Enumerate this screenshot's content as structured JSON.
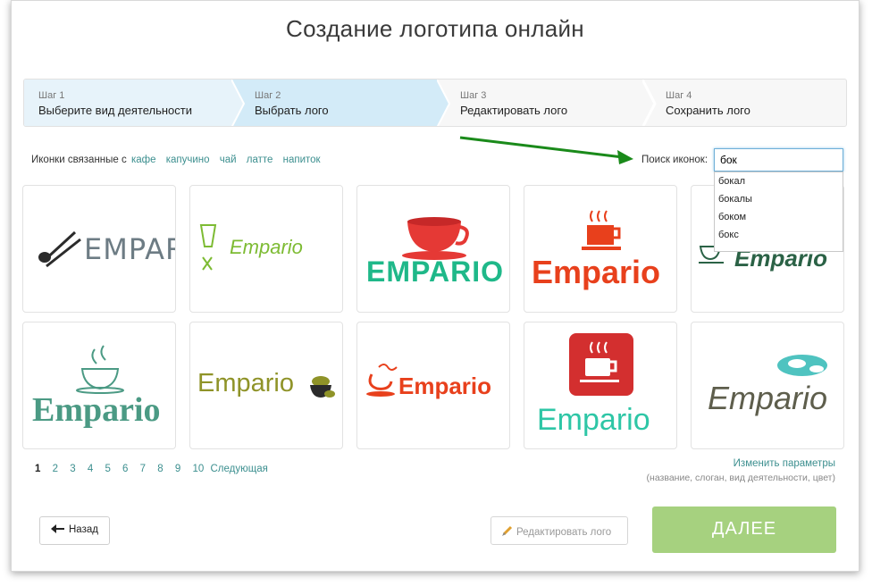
{
  "page": {
    "title": "Создание логотипа онлайн"
  },
  "steps": [
    {
      "num": "Шаг 1",
      "label": "Выберите вид деятельности"
    },
    {
      "num": "Шаг 2",
      "label": "Выбрать лого"
    },
    {
      "num": "Шаг 3",
      "label": "Редактировать лого"
    },
    {
      "num": "Шаг 4",
      "label": "Сохранить лого"
    }
  ],
  "related": {
    "prefix": "Иконки связанные с",
    "tags": [
      "кафе",
      "капучино",
      "чай",
      "латте",
      "напиток"
    ]
  },
  "search": {
    "label": "Поиск иконок:",
    "value": "бок",
    "suggestions": [
      "бокал",
      "бокалы",
      "боком",
      "бокс"
    ]
  },
  "logos": [
    {
      "text": "EMPARIO",
      "color": "#6d7c84",
      "icon": "chopsticks-sushi-icon"
    },
    {
      "text": "Empario",
      "color": "#7dbb33",
      "icon": "drink-utensils-icon"
    },
    {
      "text": "EMPARIO",
      "color": "#1fb889",
      "icon": "red-cup-icon"
    },
    {
      "text": "Empario",
      "color": "#e8401c",
      "icon": "steaming-cup-icon"
    },
    {
      "text": "Empario",
      "color": "#2b6246",
      "icon": "cup-outline-icon"
    },
    {
      "text": "Empario",
      "color": "#4b9a84",
      "icon": "coffee-cup-outline-icon"
    },
    {
      "text": "Empario",
      "color": "#8f9328",
      "icon": "coffee-beans-cup-icon"
    },
    {
      "text": "Empario",
      "color": "#e8401c",
      "icon": "swirl-cup-icon"
    },
    {
      "text": "Empario",
      "color": "#2ec6a6",
      "icon": "cup-badge-icon"
    },
    {
      "text": "Empario",
      "color": "#5e5e4c",
      "icon": "sushi-roll-icon"
    }
  ],
  "pagination": {
    "pages": [
      "1",
      "2",
      "3",
      "4",
      "5",
      "6",
      "7",
      "8",
      "9",
      "10"
    ],
    "next": "Следующая",
    "current": "1"
  },
  "change": {
    "link": "Изменить параметры",
    "hint": "(название, слоган, вид деятельности, цвет)"
  },
  "buttons": {
    "back": "Назад",
    "edit": "Редактировать лого",
    "next": "ДАЛЕЕ"
  },
  "colors": {
    "accent": "#3c8f8f",
    "next_button": "#a6d17f",
    "step_active": "#d3ebf8",
    "arrow": "#1a8a1a"
  }
}
